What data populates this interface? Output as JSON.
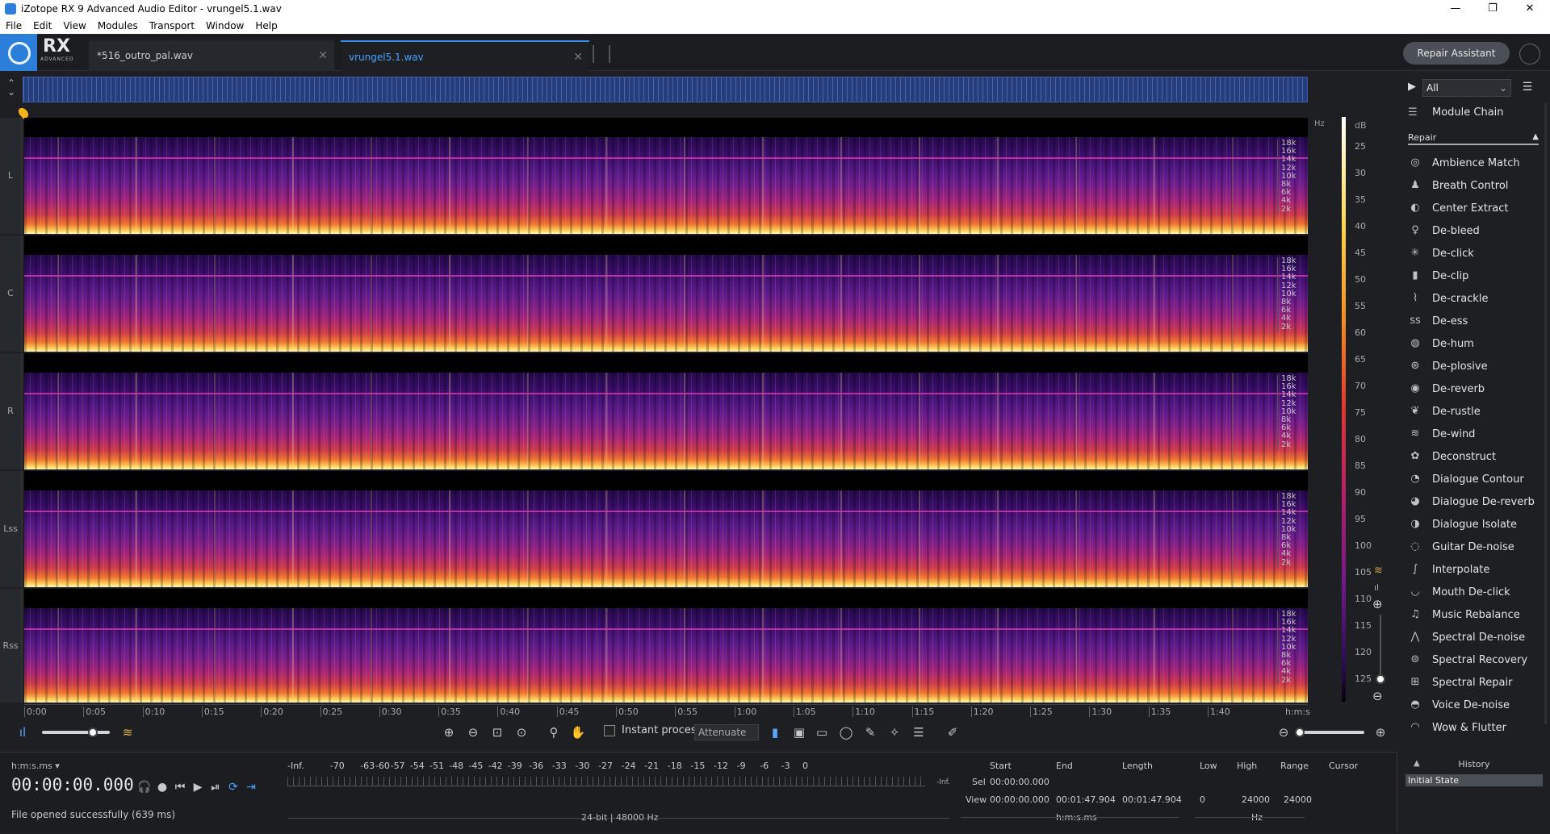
{
  "window": {
    "title": "iZotope RX 9 Advanced Audio Editor - vrungel5.1.wav",
    "minimize": "—",
    "maximize": "❐",
    "close": "✕"
  },
  "menu": [
    "File",
    "Edit",
    "View",
    "Modules",
    "Transport",
    "Window",
    "Help"
  ],
  "brand": {
    "rx": "RX",
    "edition": "ADVANCED"
  },
  "tabs": [
    {
      "label": "*516_outro_pal.wav",
      "close": "✕",
      "active": false
    },
    {
      "label": "vrungel5.1.wav",
      "close": "✕",
      "active": true
    }
  ],
  "repair_assistant": "Repair Assistant",
  "channels": [
    "L",
    "C",
    "R",
    "Lss",
    "Rss"
  ],
  "freq_unit": "Hz",
  "freq_ticks": [
    "18k",
    "16k",
    "14k",
    "12k",
    "10k",
    "8k",
    "6k",
    "4k",
    "2k"
  ],
  "db_scale": {
    "label": "dB",
    "ticks": [
      "25",
      "30",
      "35",
      "40",
      "45",
      "50",
      "55",
      "60",
      "65",
      "70",
      "75",
      "80",
      "85",
      "90",
      "95",
      "100",
      "105",
      "110",
      "115",
      "120",
      "125"
    ]
  },
  "time_axis": [
    "0:00",
    "0:05",
    "0:10",
    "0:15",
    "0:20",
    "0:25",
    "0:30",
    "0:35",
    "0:40",
    "0:45",
    "0:50",
    "0:55",
    "1:00",
    "1:05",
    "1:10",
    "1:15",
    "1:20",
    "1:25",
    "1:30",
    "1:35",
    "1:40",
    "h:m:s"
  ],
  "toolbar": {
    "instant_process": "Instant process",
    "attenuate": "Attenuate",
    "volume_level": 0.75
  },
  "bottom": {
    "time_format": "h:m:s.ms",
    "timecode": "00:00:00.000",
    "status": "File opened successfully (639 ms)",
    "meter_ticks": [
      "-Inf.",
      "-70",
      "-63",
      "-60",
      "-57",
      "-54",
      "-51",
      "-48",
      "-45",
      "-42",
      "-39",
      "-36",
      "-33",
      "-30",
      "-27",
      "-24",
      "-21",
      "-18",
      "-15",
      "-12",
      "-9",
      "-6",
      "-3",
      "0"
    ],
    "meter_inf": "-Inf.",
    "format": "24-bit | 48000 Hz"
  },
  "selection": {
    "headers": {
      "start": "Start",
      "end": "End",
      "length": "Length",
      "low": "Low",
      "high": "High",
      "range": "Range",
      "cursor": "Cursor"
    },
    "sel_label": "Sel",
    "view_label": "View",
    "sel_start": "00:00:00.000",
    "view_start": "00:00:00.000",
    "view_end": "00:01:47.904",
    "view_length": "00:01:47.904",
    "low": "0",
    "high": "24000",
    "range": "24000",
    "time_unit": "h:m:s.ms",
    "freq_unit": "Hz"
  },
  "history": {
    "title": "History",
    "items": [
      "Initial State"
    ]
  },
  "sidebar": {
    "filter": "All",
    "module_chain": "Module Chain",
    "group": "Repair",
    "modules": [
      "Ambience Match",
      "Breath Control",
      "Center Extract",
      "De-bleed",
      "De-click",
      "De-clip",
      "De-crackle",
      "De-ess",
      "De-hum",
      "De-plosive",
      "De-reverb",
      "De-rustle",
      "De-wind",
      "Deconstruct",
      "Dialogue Contour",
      "Dialogue De-reverb",
      "Dialogue Isolate",
      "Guitar De-noise",
      "Interpolate",
      "Mouth De-click",
      "Music Rebalance",
      "Spectral De-noise",
      "Spectral Recovery",
      "Spectral Repair",
      "Voice De-noise",
      "Wow & Flutter"
    ],
    "module_icons": [
      "◎",
      "♟",
      "◐",
      "♀",
      "✳",
      "▮",
      "⌇",
      "ss",
      "◍",
      "⊛",
      "◉",
      "❦",
      "≋",
      "✿",
      "◔",
      "◕",
      "◑",
      "◌",
      "∫",
      "◡",
      "♫",
      "⋀",
      "⊜",
      "⊞",
      "◓",
      "◠"
    ]
  }
}
